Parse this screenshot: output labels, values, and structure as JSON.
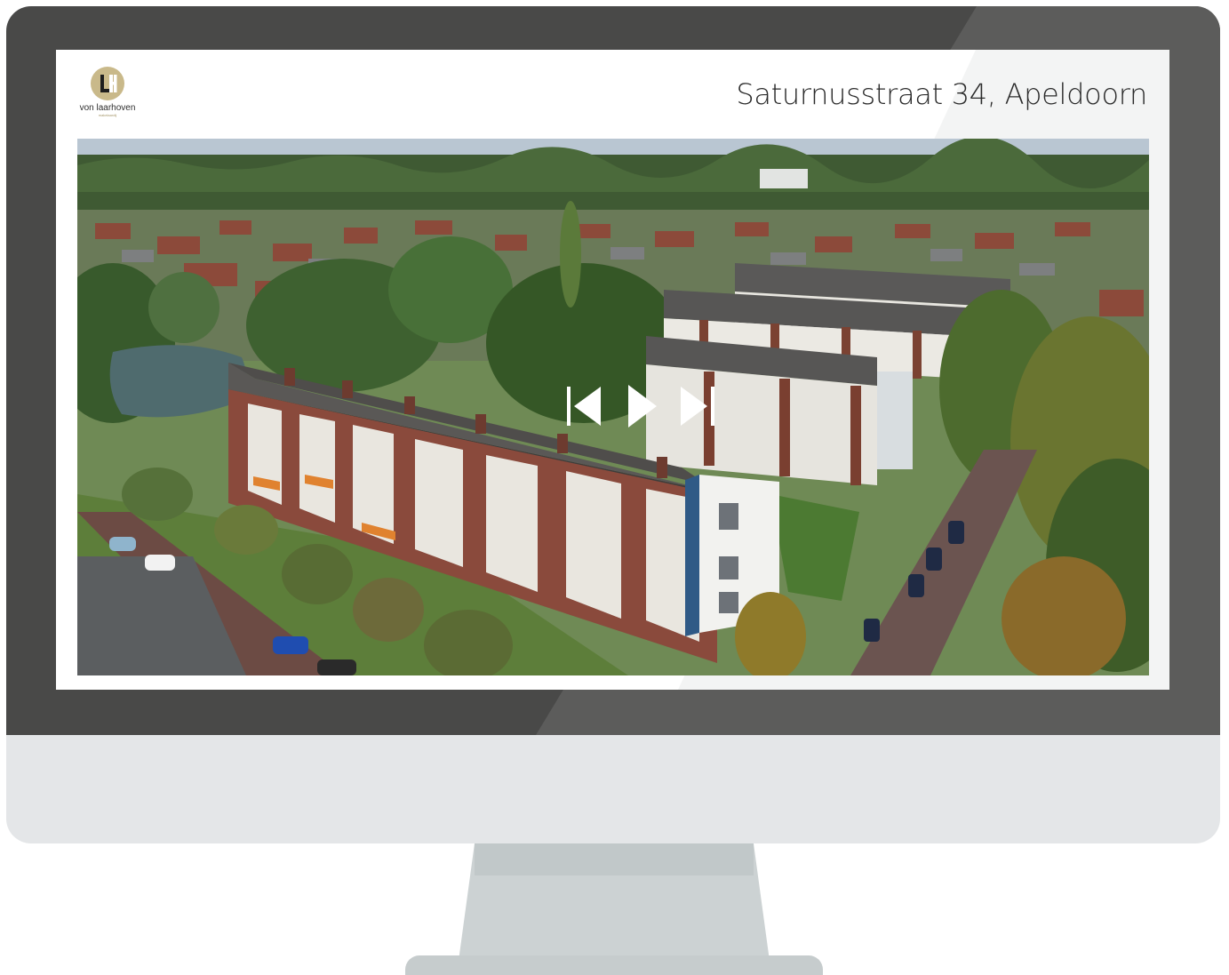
{
  "listing": {
    "address": "Saturnusstraat 34, Apeldoorn"
  },
  "brand": {
    "name": "von laarhoven",
    "tagline": "makelaardij",
    "monogram": "LH",
    "accent_color": "#c9b98a"
  },
  "player": {
    "controls": [
      {
        "name": "previous",
        "icon": "skip-back-icon"
      },
      {
        "name": "play",
        "icon": "play-icon"
      },
      {
        "name": "next",
        "icon": "skip-forward-icon"
      }
    ]
  },
  "colors": {
    "bezel": "#494948",
    "chin": "#e4e6e8",
    "stand": "#ccd2d3"
  }
}
